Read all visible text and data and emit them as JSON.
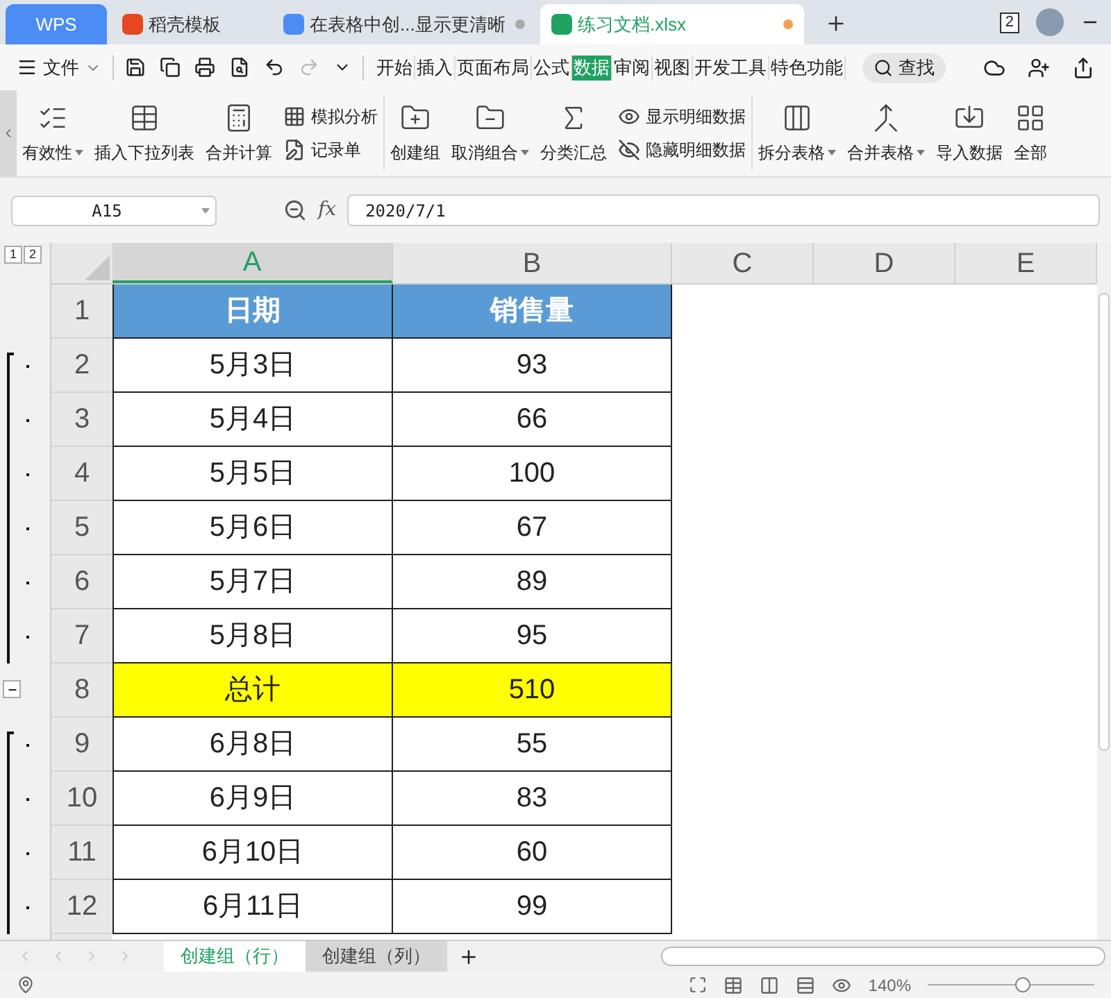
{
  "title_tabs": [
    {
      "label": "WPS",
      "kind": "home",
      "selected": false
    },
    {
      "label": "稻壳模板",
      "kind": "docer",
      "selected": false
    },
    {
      "label": "在表格中创...显示更清晰",
      "kind": "writer",
      "selected": false
    },
    {
      "label": "练习文档.xlsx",
      "kind": "sheet",
      "selected": true
    }
  ],
  "window_badge": "2",
  "file_menu": "文件",
  "menu_tabs": [
    {
      "label": "开始",
      "selected": false
    },
    {
      "label": "插入",
      "selected": false
    },
    {
      "label": "页面布局",
      "selected": false
    },
    {
      "label": "公式",
      "selected": false
    },
    {
      "label": "数据",
      "selected": true
    },
    {
      "label": "审阅",
      "selected": false
    },
    {
      "label": "视图",
      "selected": false
    },
    {
      "label": "开发工具",
      "selected": false
    },
    {
      "label": "特色功能",
      "selected": false
    }
  ],
  "search": "查找",
  "ribbon": [
    {
      "kind": "large",
      "label": "有效性",
      "dropdown": true
    },
    {
      "kind": "large",
      "label": "插入下拉列表",
      "dropdown": false
    },
    {
      "kind": "large",
      "label": "合并计算",
      "dropdown": false
    },
    {
      "kind": "small",
      "items": [
        "模拟分析",
        "记录单"
      ]
    },
    {
      "kind": "divider"
    },
    {
      "kind": "large",
      "label": "创建组",
      "dropdown": false
    },
    {
      "kind": "large",
      "label": "取消组合",
      "dropdown": true
    },
    {
      "kind": "large",
      "label": "分类汇总",
      "dropdown": false
    },
    {
      "kind": "small",
      "items": [
        "显示明细数据",
        "隐藏明细数据"
      ]
    },
    {
      "kind": "divider"
    },
    {
      "kind": "large",
      "label": "拆分表格",
      "dropdown": true
    },
    {
      "kind": "large",
      "label": "合并表格",
      "dropdown": true
    },
    {
      "kind": "large",
      "label": "导入数据",
      "dropdown": false
    },
    {
      "kind": "large",
      "label": "全部",
      "dropdown": false
    }
  ],
  "name_box": "A15",
  "function_label": "fx",
  "formula": "2020/7/1",
  "outline_levels": [
    "1",
    "2"
  ],
  "columns": [
    {
      "label": "A",
      "selected": true
    },
    {
      "label": "B",
      "selected": false
    },
    {
      "label": "C",
      "selected": false
    },
    {
      "label": "D",
      "selected": false
    },
    {
      "label": "E",
      "selected": false
    }
  ],
  "rows": [
    {
      "number": "1",
      "kind": "header",
      "cells": [
        "日期",
        "销售量"
      ]
    },
    {
      "number": "2",
      "kind": "detail",
      "cells": [
        "5月3日",
        "93"
      ]
    },
    {
      "number": "3",
      "kind": "detail",
      "cells": [
        "5月4日",
        "66"
      ]
    },
    {
      "number": "4",
      "kind": "detail",
      "cells": [
        "5月5日",
        "100"
      ]
    },
    {
      "number": "5",
      "kind": "detail",
      "cells": [
        "5月6日",
        "67"
      ]
    },
    {
      "number": "6",
      "kind": "detail",
      "cells": [
        "5月7日",
        "89"
      ]
    },
    {
      "number": "7",
      "kind": "detail",
      "cells": [
        "5月8日",
        "95"
      ]
    },
    {
      "number": "8",
      "kind": "total",
      "cells": [
        "总计",
        "510"
      ]
    },
    {
      "number": "9",
      "kind": "detail",
      "cells": [
        "6月8日",
        "55"
      ]
    },
    {
      "number": "10",
      "kind": "detail",
      "cells": [
        "6月9日",
        "83"
      ]
    },
    {
      "number": "11",
      "kind": "detail",
      "cells": [
        "6月10日",
        "60"
      ]
    },
    {
      "number": "12",
      "kind": "detail",
      "cells": [
        "6月11日",
        "99"
      ]
    }
  ],
  "sheet_tabs": [
    {
      "label": "创建组（行）",
      "selected": true
    },
    {
      "label": "创建组（列）",
      "selected": false
    }
  ],
  "zoom": {
    "reading": "140%",
    "level": 0.57
  }
}
